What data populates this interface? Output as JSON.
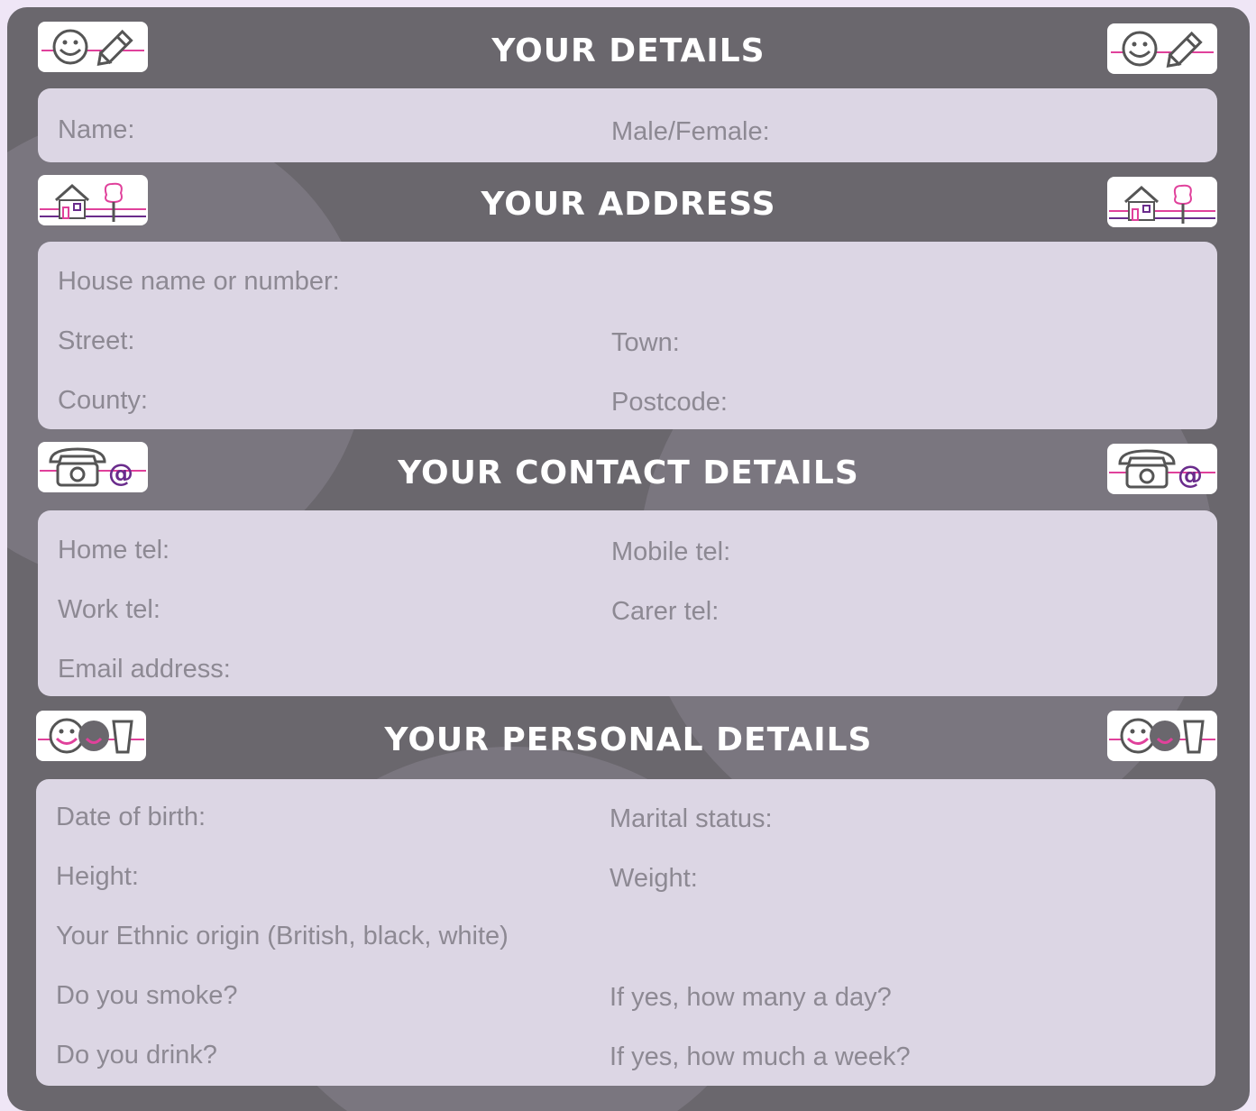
{
  "sections": {
    "details": {
      "title": "YOUR DETAILS",
      "icon": "smiley-pencil-icon",
      "fields": {
        "name": "Name:",
        "gender": "Male/Female:"
      }
    },
    "address": {
      "title": "YOUR ADDRESS",
      "icon": "house-tree-icon",
      "fields": {
        "house": "House name or number:",
        "street": "Street:",
        "town": "Town:",
        "county": "County:",
        "postcode": "Postcode:"
      }
    },
    "contact": {
      "title": "YOUR CONTACT DETAILS",
      "icon": "phone-at-icon",
      "fields": {
        "home_tel": "Home tel:",
        "mobile_tel": "Mobile tel:",
        "work_tel": "Work tel:",
        "carer_tel": "Carer tel:",
        "email": "Email address:"
      }
    },
    "personal": {
      "title": "YOUR PERSONAL DETAILS",
      "icon": "smiley-drink-icon",
      "fields": {
        "dob": "Date of birth:",
        "marital": "Marital status:",
        "height": "Height:",
        "weight": "Weight:",
        "ethnic": "Your Ethnic origin (British, black, white)",
        "smoke": "Do you smoke?",
        "smoke_count": "If yes, how many a day?",
        "drink": "Do you drink?",
        "drink_amount": "If yes, how much a week?"
      }
    }
  },
  "colors": {
    "header_bg": "#6a676d",
    "panel_bg": "#dcd6e4",
    "label_text": "#8d8993",
    "accent_pink": "#e0419b",
    "accent_purple": "#6a2c8c"
  }
}
